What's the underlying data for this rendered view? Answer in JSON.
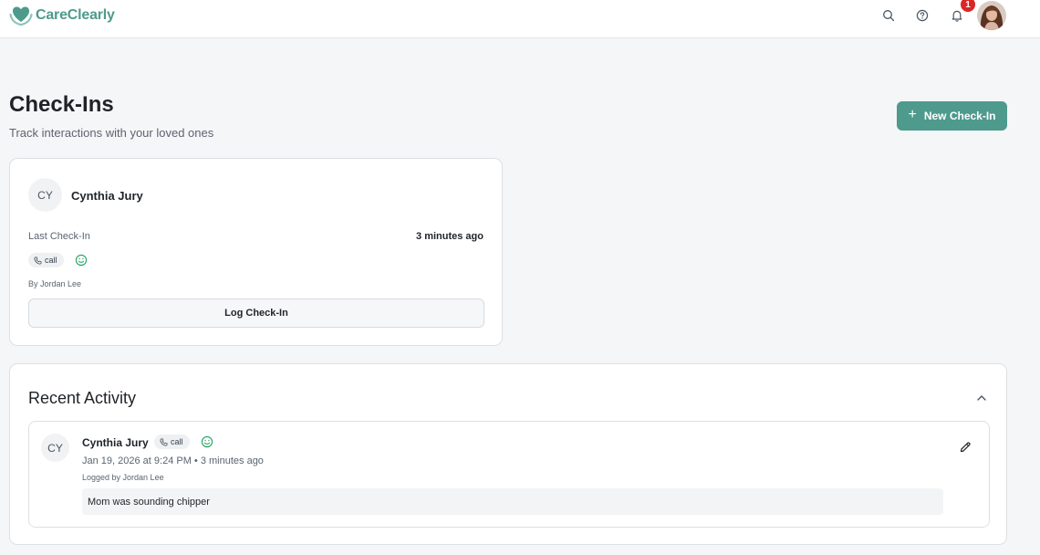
{
  "app": {
    "brand": "CareClearly",
    "brand_color": "#4e9a8d",
    "notification_count": "1"
  },
  "header": {
    "icons": [
      "search-icon",
      "help-icon",
      "bell-icon"
    ]
  },
  "page": {
    "title": "Check-Ins",
    "subtitle": "Track interactions with your loved ones",
    "new_button_label": "New Check-In"
  },
  "checkin_card": {
    "initials": "CY",
    "name": "Cynthia Jury",
    "last_label": "Last Check-In",
    "last_value": "3 minutes ago",
    "type": "call",
    "mood_icon": "smile-icon",
    "by": "By Jordan Lee",
    "log_button": "Log Check-In"
  },
  "recent": {
    "title": "Recent Activity",
    "items": [
      {
        "initials": "CY",
        "name": "Cynthia Jury",
        "type": "call",
        "mood_icon": "smile-icon",
        "when": "Jan 19, 2026 at 9:24 PM • 3 minutes ago",
        "logged_by": "Logged by Jordan Lee",
        "note": "Mom was sounding chipper"
      }
    ]
  }
}
